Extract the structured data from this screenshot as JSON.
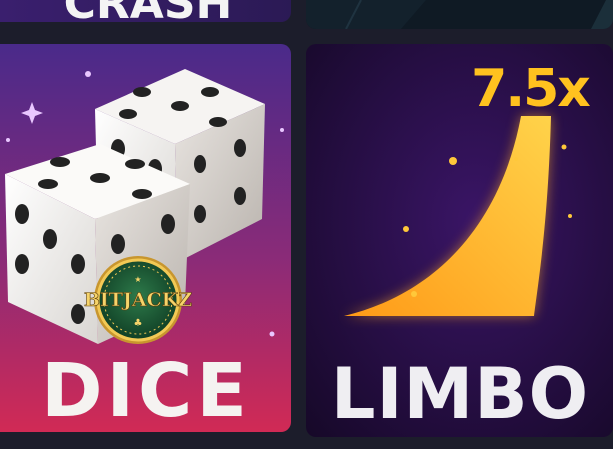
{
  "games": {
    "crash": {
      "title": "CRASH"
    },
    "dice": {
      "title": "DICE",
      "logo_text": "BITJACKZ"
    },
    "limbo": {
      "title": "LIMBO",
      "multiplier": "7.5x"
    }
  },
  "colors": {
    "page_bg": "#1c1d2b",
    "dice_gradient_top": "#4a2a8a",
    "dice_gradient_bottom": "#d12a55",
    "limbo_bg": "#2a0f4a",
    "limbo_accent": "#ffb81c"
  }
}
